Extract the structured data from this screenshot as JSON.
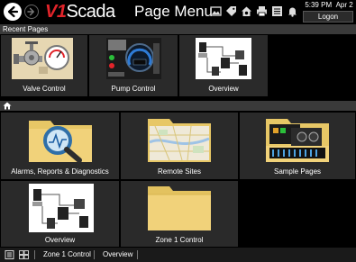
{
  "header": {
    "logo_prefix": "V1",
    "logo_suffix": "Scada",
    "title": "Page Menu",
    "time": "5:39 PM",
    "date": "Apr 2",
    "logon_label": "Logon",
    "toolbar_icons": [
      "picture-icon",
      "tag-icon",
      "home-settings-icon",
      "printer-icon",
      "list-icon",
      "bell-icon"
    ]
  },
  "recent": {
    "label": "Recent Pages",
    "tiles": [
      {
        "label": "Valve Control",
        "icon": "valve-control-thumbnail"
      },
      {
        "label": "Pump Control",
        "icon": "pump-control-thumbnail"
      },
      {
        "label": "Overview",
        "icon": "overview-thumbnail"
      }
    ]
  },
  "main": {
    "tiles": [
      {
        "label": "Alarms, Reports & Diagnostics",
        "icon": "folder-magnifier-icon"
      },
      {
        "label": "Remote Sites",
        "icon": "folder-map-icon"
      },
      {
        "label": "Sample Pages",
        "icon": "folder-panels-icon"
      },
      {
        "label": "Overview",
        "icon": "overview-thumbnail"
      },
      {
        "label": "Zone 1 Control",
        "icon": "folder-icon"
      }
    ]
  },
  "statusbar": {
    "items": [
      "Zone 1 Control",
      "Overview"
    ]
  },
  "colors": {
    "brand_red": "#e2242a",
    "folder_yellow": "#f1d27a",
    "tile_bg": "#2a2a2a",
    "bar_bg": "#3a3a3a"
  }
}
